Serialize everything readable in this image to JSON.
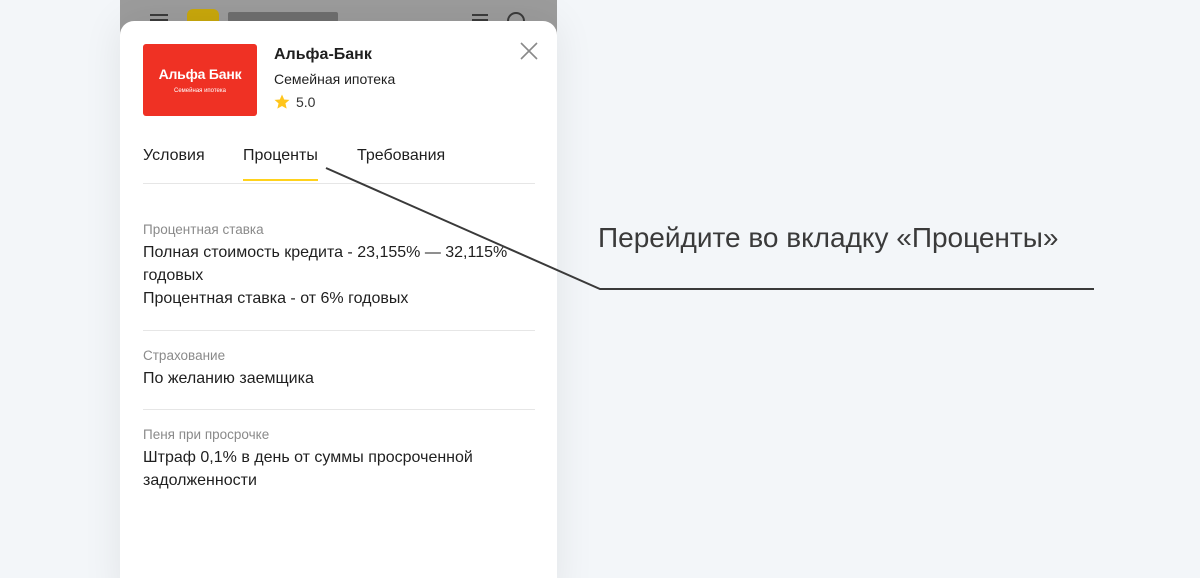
{
  "bank": {
    "logo_title": "Альфа Банк",
    "logo_subtitle": "Семейная ипотека",
    "name": "Альфа-Банк",
    "product": "Семейная ипотека",
    "rating": "5.0"
  },
  "tabs": [
    {
      "label": "Условия",
      "active": false
    },
    {
      "label": "Проценты",
      "active": true
    },
    {
      "label": "Требования",
      "active": false
    }
  ],
  "sections": [
    {
      "label": "Процентная ставка",
      "lines": [
        "Полная стоимость кредита - 23,155% — 32,115% годовых",
        "Процентная ставка - от 6% годовых"
      ]
    },
    {
      "label": "Страхование",
      "lines": [
        "По желанию заемщика"
      ]
    },
    {
      "label": "Пеня при просрочке",
      "lines": [
        "Штраф 0,1% в день от суммы просроченной задолженности"
      ]
    }
  ],
  "callout": {
    "text": "Перейдите во вкладку «Проценты»"
  },
  "colors": {
    "brand_red": "#ef3124",
    "tab_underline": "#ffd21c",
    "star": "#ffc51c"
  }
}
